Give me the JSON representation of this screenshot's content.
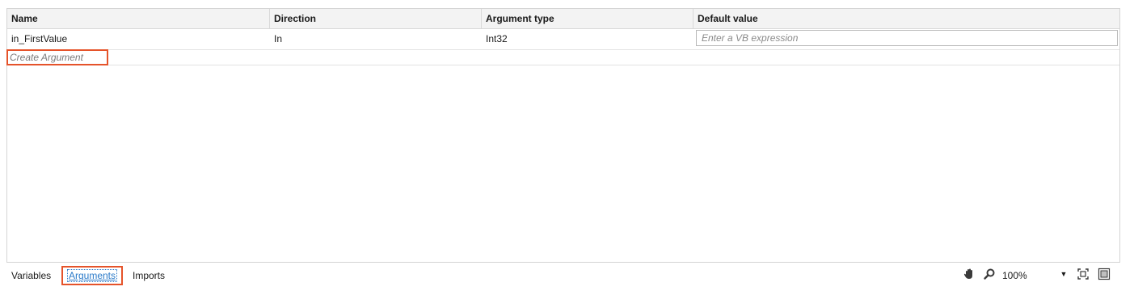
{
  "grid": {
    "headers": [
      "Name",
      "Direction",
      "Argument type",
      "Default value"
    ],
    "rows": [
      {
        "name": "in_FirstValue",
        "direction": "In",
        "type": "Int32",
        "default_placeholder": "Enter a VB expression"
      }
    ],
    "create_label": "Create Argument"
  },
  "tabs": {
    "variables": "Variables",
    "arguments": "Arguments",
    "imports": "Imports",
    "active": "Arguments"
  },
  "toolbar": {
    "zoom": "100%",
    "icons": [
      "hand-icon",
      "magnifier-icon",
      "chevron-down-icon",
      "fit-to-screen-icon",
      "overview-icon"
    ]
  },
  "colors": {
    "highlight": "#e5532a",
    "link": "#2a7ac9"
  }
}
